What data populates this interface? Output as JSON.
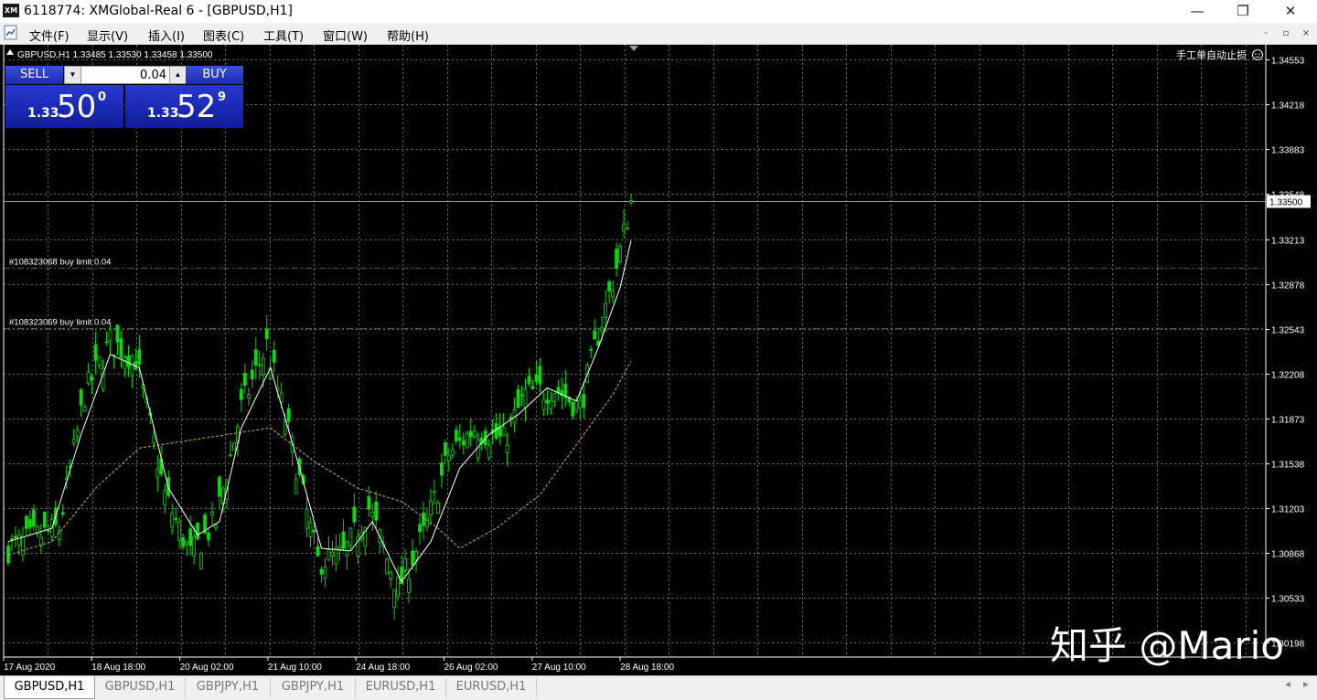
{
  "window": {
    "app_icon": "XM",
    "title": "6118774: XMGlobal-Real 6 - [GBPUSD,H1]",
    "minimize": "—",
    "maximize": "❐",
    "close": "✕"
  },
  "menu": {
    "items": [
      "文件(F)",
      "显示(V)",
      "插入(I)",
      "图表(C)",
      "工具(T)",
      "窗口(W)",
      "帮助(H)"
    ],
    "mdi_minimize": "-",
    "mdi_restore": "▫",
    "mdi_close": "×"
  },
  "chart": {
    "header": "GBPUSD,H1  1.33485 1.33530 1.33458 1.33500",
    "autotrade_label": "手工单自动止损",
    "price_ticks": [
      "1.34553",
      "1.34218",
      "1.33883",
      "1.33548",
      "1.33213",
      "1.32878",
      "1.32543",
      "1.32208",
      "1.31873",
      "1.31538",
      "1.31203",
      "1.30868",
      "1.30533",
      "1.30198"
    ],
    "current_price": "1.33500",
    "time_ticks": [
      "17 Aug 2020",
      "18 Aug 18:00",
      "20 Aug 02:00",
      "21 Aug 10:00",
      "24 Aug 18:00",
      "26 Aug 02:00",
      "27 Aug 10:00",
      "28 Aug 18:00"
    ],
    "orders": [
      {
        "label": "#108323068 buy limit 0.04",
        "price": 1.33
      },
      {
        "label": "#108323069 buy limit 0.04",
        "price": 1.3255
      }
    ],
    "watermark": "知乎 @Mario",
    "colors": {
      "background": "#000000",
      "bull_candle": "#00e000",
      "grid": "#6b6b6b",
      "fast_ma": "#ffffff",
      "slow_ma": "#d6b44a",
      "order_line": "#2e6e2e"
    }
  },
  "one_click": {
    "sell_label": "SELL",
    "buy_label": "BUY",
    "lot": "0.04",
    "sell_prefix": "1.33",
    "sell_big": "50",
    "sell_sup": "0",
    "buy_prefix": "1.33",
    "buy_big": "52",
    "buy_sup": "9",
    "spin_down": "▼",
    "spin_up": "▲"
  },
  "tabs": [
    "GBPUSD,H1",
    "GBPUSD,H1",
    "GBPJPY,H1",
    "GBPJPY,H1",
    "EURUSD,H1",
    "EURUSD,H1"
  ],
  "tab_arrows": {
    "left": "◄",
    "right": "►"
  },
  "chart_data": {
    "type": "candlestick",
    "symbol": "GBPUSD",
    "timeframe": "H1",
    "last_bar": {
      "open": 1.33485,
      "high": 1.3353,
      "low": 1.33458,
      "close": 1.335
    },
    "price_range": [
      1.30087,
      1.34665
    ],
    "x_labels": [
      "17 Aug 2020",
      "18 Aug 18:00",
      "20 Aug 02:00",
      "21 Aug 10:00",
      "24 Aug 18:00",
      "26 Aug 02:00",
      "27 Aug 10:00",
      "28 Aug 18:00"
    ],
    "close_path": [
      [
        0,
        1.309
      ],
      [
        14,
        1.3105
      ],
      [
        21,
        1.3205
      ],
      [
        28,
        1.3245
      ],
      [
        35,
        1.3232
      ],
      [
        43,
        1.313
      ],
      [
        50,
        1.3085
      ],
      [
        57,
        1.311
      ],
      [
        64,
        1.3195
      ],
      [
        71,
        1.3242
      ],
      [
        78,
        1.3165
      ],
      [
        85,
        1.308
      ],
      [
        92,
        1.3085
      ],
      [
        99,
        1.312
      ],
      [
        107,
        1.306
      ],
      [
        114,
        1.31
      ],
      [
        121,
        1.316
      ],
      [
        128,
        1.318
      ],
      [
        136,
        1.317
      ],
      [
        142,
        1.3205
      ],
      [
        150,
        1.321
      ],
      [
        157,
        1.3195
      ],
      [
        162,
        1.325
      ],
      [
        167,
        1.33
      ],
      [
        171,
        1.335
      ]
    ],
    "fast_ma": [
      [
        0,
        1.3095
      ],
      [
        12,
        1.3105
      ],
      [
        20,
        1.3175
      ],
      [
        28,
        1.3235
      ],
      [
        36,
        1.3225
      ],
      [
        44,
        1.3135
      ],
      [
        52,
        1.31
      ],
      [
        58,
        1.311
      ],
      [
        64,
        1.318
      ],
      [
        72,
        1.3225
      ],
      [
        80,
        1.315
      ],
      [
        86,
        1.309
      ],
      [
        94,
        1.3088
      ],
      [
        100,
        1.311
      ],
      [
        108,
        1.3065
      ],
      [
        116,
        1.3095
      ],
      [
        124,
        1.315
      ],
      [
        132,
        1.3175
      ],
      [
        140,
        1.319
      ],
      [
        148,
        1.321
      ],
      [
        156,
        1.32
      ],
      [
        162,
        1.324
      ],
      [
        168,
        1.3285
      ],
      [
        171,
        1.332
      ]
    ],
    "slow_ma": [
      [
        0,
        1.3085
      ],
      [
        12,
        1.3095
      ],
      [
        24,
        1.3135
      ],
      [
        36,
        1.3165
      ],
      [
        48,
        1.317
      ],
      [
        60,
        1.3175
      ],
      [
        72,
        1.318
      ],
      [
        84,
        1.3155
      ],
      [
        96,
        1.3135
      ],
      [
        108,
        1.3125
      ],
      [
        118,
        1.3105
      ],
      [
        124,
        1.309
      ],
      [
        134,
        1.3105
      ],
      [
        146,
        1.313
      ],
      [
        158,
        1.3175
      ],
      [
        166,
        1.3205
      ],
      [
        171,
        1.323
      ]
    ],
    "num_bars": 172
  }
}
